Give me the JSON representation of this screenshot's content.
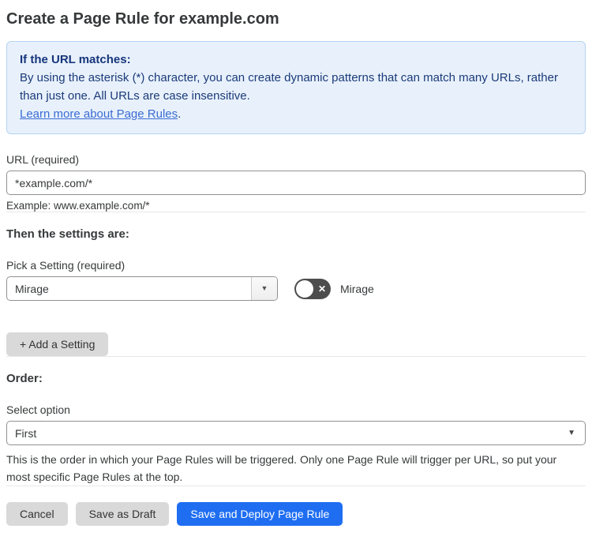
{
  "page": {
    "title": "Create a Page Rule for example.com"
  },
  "info_box": {
    "heading": "If the URL matches:",
    "body": "By using the asterisk (*) character, you can create dynamic patterns that can match many URLs, rather than just one. All URLs are case insensitive.",
    "link_label": "Learn more about Page Rules",
    "link_suffix": "."
  },
  "url_field": {
    "label": "URL (required)",
    "value": "*example.com/*",
    "helper": "Example: www.example.com/*"
  },
  "settings_section": {
    "heading": "Then the settings are:",
    "picker_label": "Pick a Setting (required)",
    "picker_value": "Mirage",
    "toggle_label": "Mirage",
    "toggle_state": "off",
    "add_setting_label": "+ Add a Setting"
  },
  "order_section": {
    "heading": "Order:",
    "select_label": "Select option",
    "select_value": "First",
    "helper": "This is the order in which your Page Rules will be triggered. Only one Page Rule will trigger per URL, so put your most specific Page Rules at the top."
  },
  "footer": {
    "cancel_label": "Cancel",
    "save_draft_label": "Save as Draft",
    "save_deploy_label": "Save and Deploy Page Rule"
  },
  "icons": {
    "dropdown_arrow": "▼",
    "select_arrow": "▼",
    "toggle_x": "✕"
  },
  "colors": {
    "info_bg": "#e8f1fb",
    "info_border": "#b3d4f1",
    "info_text": "#1b3a7a",
    "link": "#3b6cd3",
    "primary_button": "#1f6ef2",
    "gray_button": "#d9d9d9",
    "toggle_off": "#4d4d4d"
  }
}
